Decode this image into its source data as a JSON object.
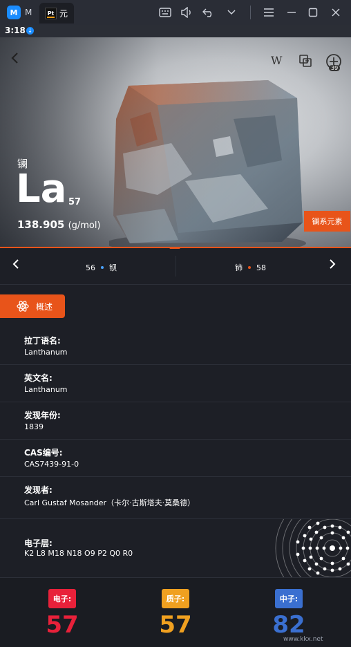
{
  "window": {
    "app_tab_label": "M",
    "active_tab_label": "元",
    "active_tab_logo": "Pt"
  },
  "status": {
    "time": "3:18"
  },
  "hero": {
    "chinese_name": "镧",
    "symbol": "La",
    "atomic_number": "57",
    "mass_value": "138.905",
    "mass_unit": "(g/mol)",
    "series_tag": "镧系元素",
    "badge": "39",
    "wiki_label": "W"
  },
  "nav": {
    "prev_number": "56",
    "prev_name": "钡",
    "next_name": "铈",
    "next_number": "58"
  },
  "section": {
    "tab_label": "概述"
  },
  "info": [
    {
      "label": "拉丁语名:",
      "value": "Lanthanum"
    },
    {
      "label": "英文名:",
      "value": "Lanthanum"
    },
    {
      "label": "发现年份:",
      "value": "1839"
    },
    {
      "label": "CAS编号:",
      "value": "CAS7439-91-0"
    },
    {
      "label": "发现者:",
      "value": "Carl Gustaf Mosander（卡尔·古斯塔夫·莫桑德）"
    }
  ],
  "shell": {
    "label": "电子层:",
    "value": "K2 L8 M18 N18 O9 P2 Q0 R0"
  },
  "counts": {
    "electrons": {
      "label": "电子:",
      "value": "57",
      "color": "#e8213a"
    },
    "protons": {
      "label": "质子:",
      "value": "57",
      "color": "#f0a020"
    },
    "neutrons": {
      "label": "中子:",
      "value": "82",
      "color": "#3a6fd0"
    }
  },
  "watermark": "www.kkx.net",
  "colors": {
    "accent": "#e8541a",
    "background": "#1d1f26"
  }
}
